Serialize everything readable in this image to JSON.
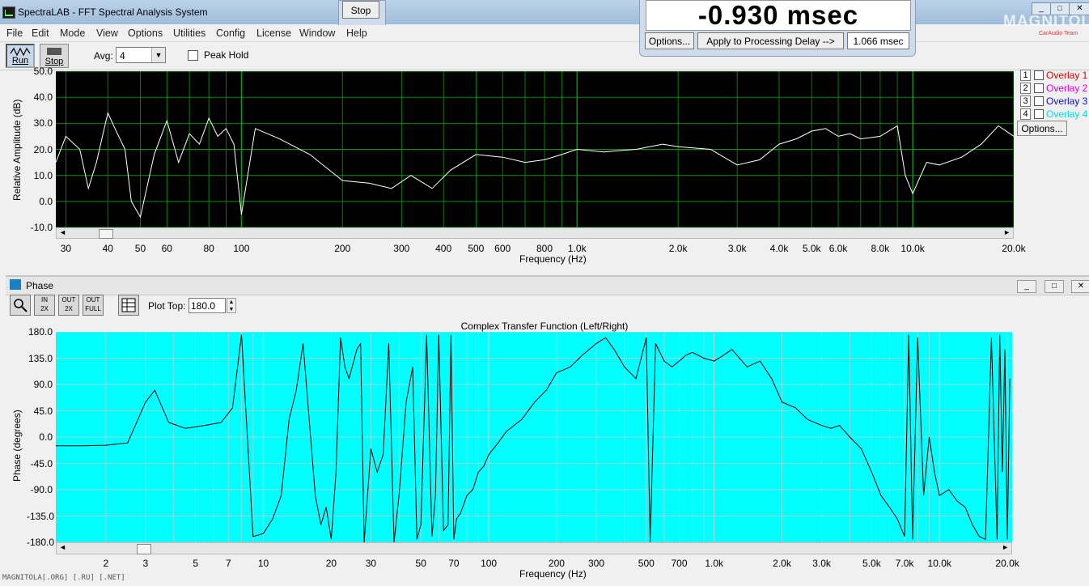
{
  "app": {
    "title": "SpectraLAB - FFT Spectral Analysis System"
  },
  "menu": [
    "File",
    "Edit",
    "Mode",
    "View",
    "Options",
    "Utilities",
    "Config",
    "License",
    "Window",
    "Help"
  ],
  "toolbar": {
    "run_label": "Run",
    "stop_label": "Stop",
    "avg_label": "Avg:",
    "avg_value": "4",
    "peak_hold_label": "Peak Hold",
    "peak_hold_checked": false
  },
  "stop_popup": {
    "label": "Stop"
  },
  "delay_popup": {
    "value": "-0.930 msec",
    "options_label": "Options...",
    "apply_label": "Apply to Processing Delay -->",
    "processing_delay": "1.066 msec"
  },
  "logo": {
    "text": "MAGNITOLA",
    "subtext": "CarAudio Team"
  },
  "spectrum": {
    "ylabel": "Relative Amplitude (dB)",
    "xlabel": "Frequency (Hz)",
    "y_ticks": [
      "50.0",
      "40.0",
      "30.0",
      "20.0",
      "10.0",
      "0.0",
      "-10.0"
    ],
    "x_ticks": [
      "30",
      "40",
      "50",
      "60",
      "80",
      "100",
      "200",
      "300",
      "400",
      "500",
      "600",
      "800",
      "1.0k",
      "2.0k",
      "3.0k",
      "4.0k",
      "5.0k",
      "6.0k",
      "8.0k",
      "10.0k",
      "20.0k"
    ],
    "colors": {
      "background": "#000000",
      "grid": "#00a000",
      "trace": "#ffffff"
    },
    "overlays": [
      {
        "num": "1",
        "label": "Overlay 1",
        "color": "#e00000"
      },
      {
        "num": "2",
        "label": "Overlay 2",
        "color": "#e000e0"
      },
      {
        "num": "3",
        "label": "Overlay 3",
        "color": "#1010c0"
      },
      {
        "num": "4",
        "label": "Overlay 4",
        "color": "#00e0e0"
      }
    ],
    "overlay_options_label": "Options..."
  },
  "phase": {
    "window_title": "Phase",
    "plot_top_label": "Plot Top:",
    "plot_top_value": "180.0",
    "chart_title": "Complex Transfer Function (Left/Right)",
    "ylabel": "Phase (degrees)",
    "xlabel": "Frequency (Hz)",
    "y_ticks": [
      "180.0",
      "135.0",
      "90.0",
      "45.0",
      "0.0",
      "-45.0",
      "-90.0",
      "-135.0",
      "-180.0"
    ],
    "x_ticks": [
      "2",
      "3",
      "5",
      "7",
      "10",
      "20",
      "30",
      "50",
      "70",
      "100",
      "200",
      "300",
      "500",
      "700",
      "1.0k",
      "2.0k",
      "3.0k",
      "5.0k",
      "7.0k",
      "10.0k",
      "20.0k"
    ],
    "colors": {
      "background": "#00ffff",
      "grid": "#9ad8d8",
      "trace": "#000000"
    },
    "toolbar_buttons": [
      "zoom",
      "in-2x",
      "out-2x",
      "out-full",
      "table"
    ]
  },
  "chart_data": [
    {
      "type": "line",
      "title": "",
      "xlabel": "Frequency (Hz)",
      "ylabel": "Relative Amplitude (dB)",
      "x_scale": "log",
      "xlim": [
        28,
        20000
      ],
      "ylim": [
        -10,
        50
      ],
      "grid": true,
      "series": [
        {
          "x": [
            28,
            30,
            33,
            35,
            37,
            40,
            42,
            45,
            47,
            50,
            55,
            60,
            65,
            70,
            75,
            80,
            85,
            90,
            95,
            100,
            110,
            130,
            160,
            200,
            240,
            280,
            320,
            370,
            420,
            500,
            600,
            700,
            800,
            900,
            1000,
            1200,
            1500,
            1800,
            2000,
            2500,
            3000,
            3500,
            4000,
            4500,
            5000,
            5500,
            6000,
            6500,
            7000,
            8000,
            9000,
            9500,
            10000,
            11000,
            12000,
            14000,
            16000,
            18000,
            20000
          ],
          "y": [
            15,
            25,
            20,
            5,
            15,
            34,
            28,
            20,
            0,
            -6,
            18,
            31,
            15,
            26,
            22,
            32,
            25,
            28,
            22,
            -5,
            28,
            24,
            18,
            8,
            7,
            5,
            10,
            5,
            12,
            18,
            17,
            15,
            16,
            18,
            20,
            19,
            20,
            22,
            21,
            20,
            14,
            16,
            22,
            24,
            27,
            28,
            25,
            26,
            24,
            25,
            29,
            10,
            3,
            15,
            14,
            17,
            22,
            29,
            25
          ]
        }
      ]
    },
    {
      "type": "line",
      "title": "Complex Transfer Function (Left/Right)",
      "xlabel": "Frequency (Hz)",
      "ylabel": "Phase (degrees)",
      "x_scale": "log",
      "xlim": [
        1.2,
        21000
      ],
      "ylim": [
        -180,
        180
      ],
      "grid": true,
      "series": [
        {
          "x": [
            1.2,
            1.6,
            2,
            2.5,
            3,
            3.3,
            3.8,
            4.5,
            5.5,
            6.5,
            7.3,
            8,
            9,
            10,
            11,
            12,
            13,
            14,
            15,
            17,
            18,
            19,
            20,
            21,
            22,
            23,
            24,
            26,
            27,
            28,
            30,
            32,
            34,
            36,
            38,
            40,
            43,
            46,
            48,
            50,
            53,
            56,
            58,
            60,
            63,
            66,
            68,
            70,
            72,
            75,
            80,
            85,
            90,
            95,
            100,
            110,
            120,
            140,
            160,
            180,
            200,
            230,
            260,
            300,
            330,
            360,
            400,
            450,
            500,
            520,
            550,
            600,
            650,
            700,
            750,
            800,
            900,
            1000,
            1100,
            1200,
            1400,
            1600,
            1800,
            2000,
            2300,
            2600,
            3000,
            3300,
            3600,
            4000,
            4500,
            5000,
            5500,
            6000,
            6500,
            7000,
            7300,
            7600,
            8000,
            8500,
            9000,
            9500,
            10000,
            11000,
            12000,
            13000,
            14000,
            15000,
            16000,
            17000,
            18000,
            18500,
            19000,
            19500,
            20000,
            20500
          ],
          "y": [
            -15,
            -15,
            -14,
            -10,
            60,
            80,
            25,
            15,
            20,
            25,
            50,
            175,
            -170,
            -165,
            -140,
            -100,
            30,
            80,
            160,
            -100,
            -150,
            -120,
            -175,
            -60,
            170,
            120,
            100,
            150,
            160,
            -180,
            -20,
            -60,
            -30,
            160,
            -180,
            -100,
            60,
            120,
            -175,
            -150,
            175,
            -170,
            -100,
            175,
            -160,
            -150,
            175,
            -175,
            -140,
            -130,
            -100,
            -90,
            -60,
            -50,
            -30,
            -10,
            10,
            30,
            60,
            80,
            110,
            120,
            140,
            160,
            170,
            150,
            120,
            100,
            170,
            -180,
            160,
            130,
            120,
            130,
            140,
            145,
            135,
            130,
            140,
            150,
            120,
            130,
            100,
            60,
            50,
            30,
            20,
            15,
            20,
            0,
            -20,
            -60,
            -100,
            -120,
            -140,
            -170,
            175,
            -175,
            170,
            -100,
            0,
            -60,
            -100,
            -90,
            -110,
            -120,
            -150,
            -170,
            -175,
            170,
            -175,
            175,
            -60,
            150,
            -175,
            100
          ]
        }
      ]
    }
  ],
  "watermark": "MAGNITOLA[.ORG] [.RU] [.NET]"
}
